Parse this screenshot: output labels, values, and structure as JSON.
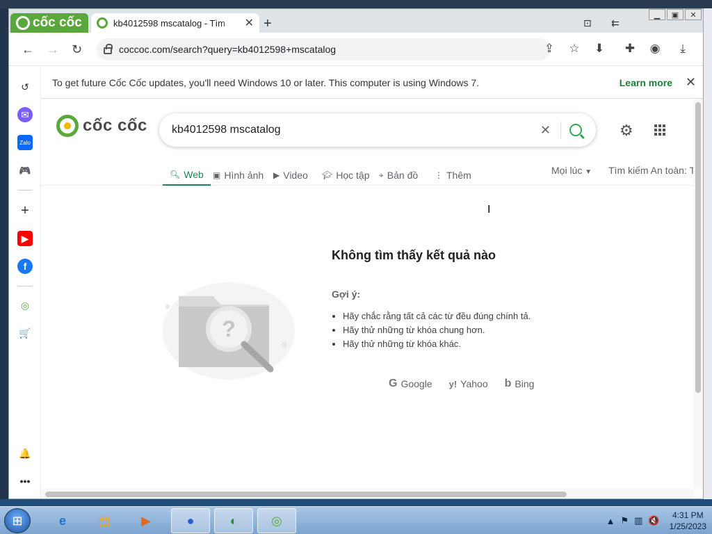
{
  "browser": {
    "brand": "cốc cốc",
    "tab_title": "kb4012598 mscatalog - Tìm",
    "url": "coccoc.com/search?query=kb4012598+mscatalog"
  },
  "infobar": {
    "message": "To get future Cốc Cốc updates, you'll need Windows 10 or later. This computer is using Windows 7.",
    "learn_more": "Learn more"
  },
  "search": {
    "logo_text": "cốc cốc",
    "query": "kb4012598 mscatalog"
  },
  "tabs": [
    {
      "label": "Web"
    },
    {
      "label": "Hình ảnh"
    },
    {
      "label": "Video"
    },
    {
      "label": "Học tập"
    },
    {
      "label": "Bản đồ"
    },
    {
      "label": "Thêm"
    }
  ],
  "filters": {
    "time": "Mọi lúc",
    "safe_search": "Tìm kiếm An toàn: Tắ"
  },
  "empty": {
    "title": "Không tìm thấy kết quả nào",
    "hint_label": "Gợi ý:",
    "tips": [
      "Hãy chắc rằng tất cả các từ đều đúng chính tả.",
      "Hãy thử những từ khóa chung hơn.",
      "Hãy thử những từ khóa khác."
    ],
    "engines": [
      "Google",
      "Yahoo",
      "Bing"
    ]
  },
  "taskbar": {
    "time": "4:31 PM",
    "date": "1/25/2023"
  },
  "colors": {
    "brand_green": "#5aa83c",
    "link_green": "#1a7f37"
  }
}
